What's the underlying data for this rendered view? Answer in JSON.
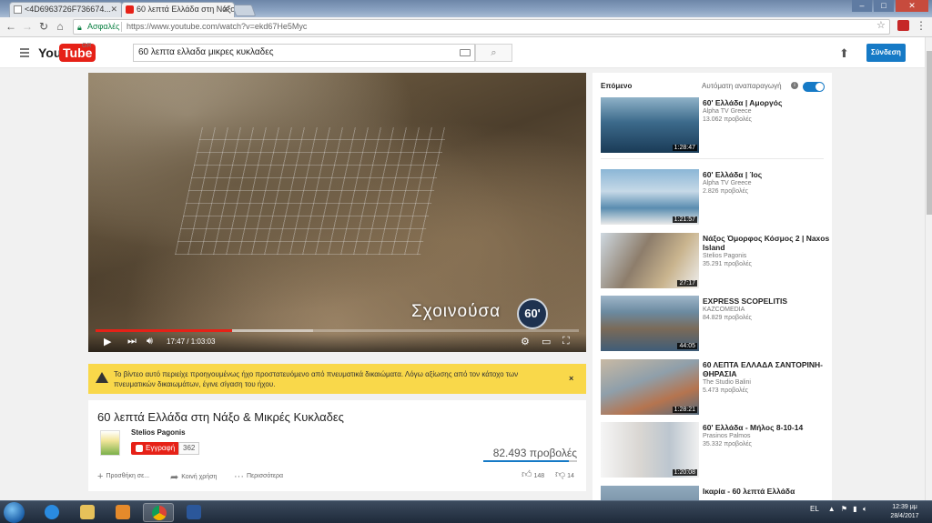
{
  "browser": {
    "tabs": [
      {
        "title": "<4D6963726F736674...",
        "active": false
      },
      {
        "title": "60 λεπτά Ελλάδα στη Νάξο",
        "active": true
      }
    ],
    "secure_label": "Ασφαλές",
    "url": "https://www.youtube.com/watch?v=ekd67He5Myc"
  },
  "youtube": {
    "logo_you": "You",
    "logo_tube": "Tube",
    "region": "GR",
    "search_query": "60 λεπτα ελλαδα μικρες κυκλαδες",
    "signin_label": "Σύνδεση"
  },
  "player": {
    "overlay_text": "Σχοινούσα",
    "channel_badge": "60'",
    "time_current": "17:47",
    "time_total": "1:03:03",
    "progress": 0.282,
    "buffered": 0.45
  },
  "notice": {
    "message": "Το βίντεο αυτό περιείχε προηγουμένως ήχο προστατευόμενο από πνευματικά δικαιώματα. Λόγω αξίωσης από τον κάτοχο των πνευματικών δικαιωμάτων, έγινε σίγαση του ήχου.",
    "close": "×"
  },
  "video": {
    "title": "60 λεπτά Ελλάδα στη Νάξο & Μικρές Κυκλαδες",
    "channel": "Stelios Pagonis",
    "subscribe_label": "Εγγραφή",
    "subscribers": "362",
    "views": "82.493 προβολές",
    "add_to": "Προσθήκη σε...",
    "share": "Κοινή χρήση",
    "more": "Περισσότερα",
    "likes": "148",
    "dislikes": "14",
    "like_ratio": 0.91
  },
  "sidebar": {
    "next_label": "Επόμενο",
    "autoplay_label": "Αυτόματη αναπαραγωγή",
    "autoplay_on": true,
    "items": [
      {
        "title": "60' Ελλάδα | Αμοργός",
        "channel": "Alpha TV Greece",
        "views": "13.062 προβολές",
        "duration": "1:28:47"
      },
      {
        "title": "60' Ελλάδα | Ίος",
        "channel": "Alpha TV Greece",
        "views": "2.826 προβολές",
        "duration": "1:21:57"
      },
      {
        "title": "Νάξος Όμορφος Κόσμος 2 | Naxos Island",
        "channel": "Stelios Pagonis",
        "views": "35.291 προβολές",
        "duration": "27:17"
      },
      {
        "title": "EXPRESS SCOPELITIS",
        "channel": "KAZCOMEDIA",
        "views": "84.829 προβολές",
        "duration": "44:05"
      },
      {
        "title": "60 ΛΕΠΤΑ ΕΛΛΑΔΑ ΣΑΝΤΟΡΙΝΗ-ΘΗΡΑΣΙΑ",
        "channel": "The Studio Balini",
        "views": "5.473 προβολές",
        "duration": "1:28:21"
      },
      {
        "title": "60' Ελλάδα - Μήλος 8-10-14",
        "channel": "Prasinos Palmos",
        "views": "35.332 προβολές",
        "duration": "1:20:08"
      },
      {
        "title": "Ικαρία - 60 λεπτά Ελλάδα",
        "channel": "",
        "views": "",
        "duration": ""
      }
    ]
  },
  "taskbar": {
    "lang": "EL",
    "time": "12:39 μμ",
    "date": "28/4/2017"
  }
}
